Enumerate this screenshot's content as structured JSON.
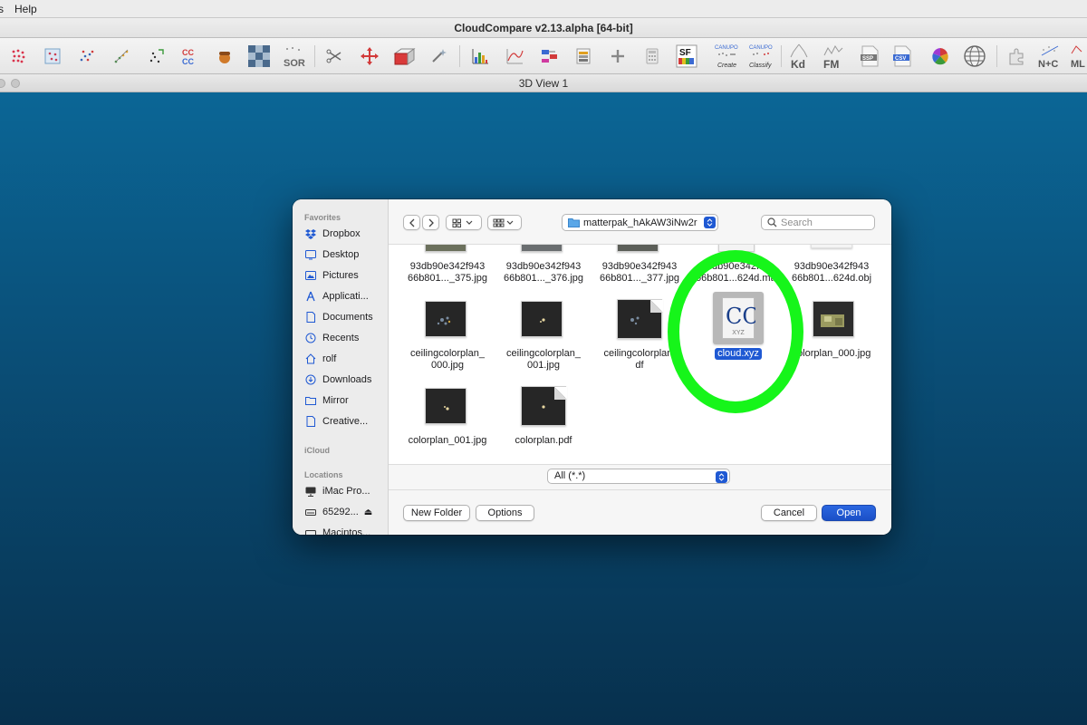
{
  "menubar": {
    "items": [
      "s",
      "Help"
    ]
  },
  "window": {
    "title": "CloudCompare v2.13.alpha [64-bit]"
  },
  "toolbar": {
    "tools": [
      {
        "icon": "sample-points-icon",
        "label": ""
      },
      {
        "icon": "subsample-icon",
        "label": ""
      },
      {
        "icon": "scatter-points-icon",
        "label": ""
      },
      {
        "icon": "gradient-points-icon",
        "label": ""
      },
      {
        "icon": "compute-points-icon",
        "label": ""
      },
      {
        "icon": "cc-cc-icon",
        "label": "CC\nCC"
      },
      {
        "icon": "acorn-icon",
        "label": ""
      },
      {
        "icon": "checker-icon",
        "label": ""
      },
      {
        "icon": "sor-icon",
        "label": "SOR"
      },
      {
        "icon": "scissors-icon",
        "label": ""
      },
      {
        "icon": "translate-icon",
        "label": ""
      },
      {
        "icon": "box-icon",
        "label": ""
      },
      {
        "icon": "magic-wand-icon",
        "label": ""
      },
      {
        "icon": "histogram-icon",
        "label": ""
      },
      {
        "icon": "curve-icon",
        "label": ""
      },
      {
        "icon": "sf-arithmetic-icon",
        "label": ""
      },
      {
        "icon": "sf-gradient-icon",
        "label": ""
      },
      {
        "icon": "plus-icon",
        "label": ""
      },
      {
        "icon": "calculator-icon",
        "label": ""
      },
      {
        "icon": "sf-icon",
        "label": "SF"
      },
      {
        "icon": "canupo-create-icon",
        "label": "Create",
        "top": "CANUPO"
      },
      {
        "icon": "canupo-classify-icon",
        "label": "Classify",
        "top": "CANUPO"
      },
      {
        "icon": "kd-tree-icon",
        "label": "Kd"
      },
      {
        "icon": "fm-icon",
        "label": "FM"
      },
      {
        "icon": "ssp-icon",
        "label": "SSP"
      },
      {
        "icon": "csv-icon",
        "label": "CSV"
      },
      {
        "icon": "color-wheel-icon",
        "label": ""
      },
      {
        "icon": "globe-icon",
        "label": ""
      },
      {
        "icon": "plugin-icon",
        "label": ""
      },
      {
        "icon": "n-plus-c-icon",
        "label": "N+C"
      },
      {
        "icon": "ml-icon",
        "label": "ML"
      }
    ]
  },
  "view": {
    "title": "3D View 1"
  },
  "dialog": {
    "sidebar": {
      "favorites_heading": "Favorites",
      "favorites": [
        {
          "label": "Dropbox",
          "icon": "dropbox-icon"
        },
        {
          "label": "Desktop",
          "icon": "desktop-icon"
        },
        {
          "label": "Pictures",
          "icon": "pictures-icon"
        },
        {
          "label": "Applicati...",
          "icon": "applications-icon"
        },
        {
          "label": "Documents",
          "icon": "documents-icon"
        },
        {
          "label": "Recents",
          "icon": "recents-icon"
        },
        {
          "label": "rolf",
          "icon": "home-icon"
        },
        {
          "label": "Downloads",
          "icon": "downloads-icon"
        },
        {
          "label": "Mirror",
          "icon": "folder-icon"
        },
        {
          "label": "Creative...",
          "icon": "document-icon"
        }
      ],
      "icloud_heading": "iCloud",
      "locations_heading": "Locations",
      "locations": [
        {
          "label": "iMac Pro...",
          "icon": "imac-icon"
        },
        {
          "label": "65292...",
          "icon": "drive-icon",
          "eject": "⏏"
        },
        {
          "label": "Macintos...",
          "icon": "disk-icon"
        }
      ]
    },
    "path": "matterpak_hAkAW3iNw2r",
    "search_placeholder": "Search",
    "files_row1": [
      {
        "name1": "93db90e342f943",
        "name2": "66b801..._375.jpg"
      },
      {
        "name1": "93db90e342f943",
        "name2": "66b801..._376.jpg"
      },
      {
        "name1": "93db90e342f943",
        "name2": "66b801..._377.jpg"
      },
      {
        "name1": "...db90e342f...",
        "name2": "66b801...624d.mtl"
      },
      {
        "name1": "93db90e342f943",
        "name2": "66b801...624d.obj"
      }
    ],
    "files_row2": [
      {
        "name1": "ceilingcolorplan_",
        "name2": "000.jpg"
      },
      {
        "name1": "ceilingcolorplan_",
        "name2": "001.jpg"
      },
      {
        "name1": "ceilingcolorplan.",
        "name2": "df"
      },
      {
        "name1": "cloud.xyz",
        "name2": ""
      },
      {
        "name1": "colorplan_000.jpg",
        "name2": ""
      }
    ],
    "files_row3": [
      {
        "name1": "colorplan_001.jpg",
        "name2": ""
      },
      {
        "name1": "colorplan.pdf",
        "name2": ""
      }
    ],
    "xyz_badge": "XYZ",
    "filter": "All (*.*)",
    "buttons": {
      "new_folder": "New Folder",
      "options": "Options",
      "cancel": "Cancel",
      "open": "Open"
    }
  },
  "colors": {
    "accent": "#1f59d3",
    "annotation": "#16f51a",
    "background_top": "#0b6696",
    "background_bottom": "#07304d"
  }
}
